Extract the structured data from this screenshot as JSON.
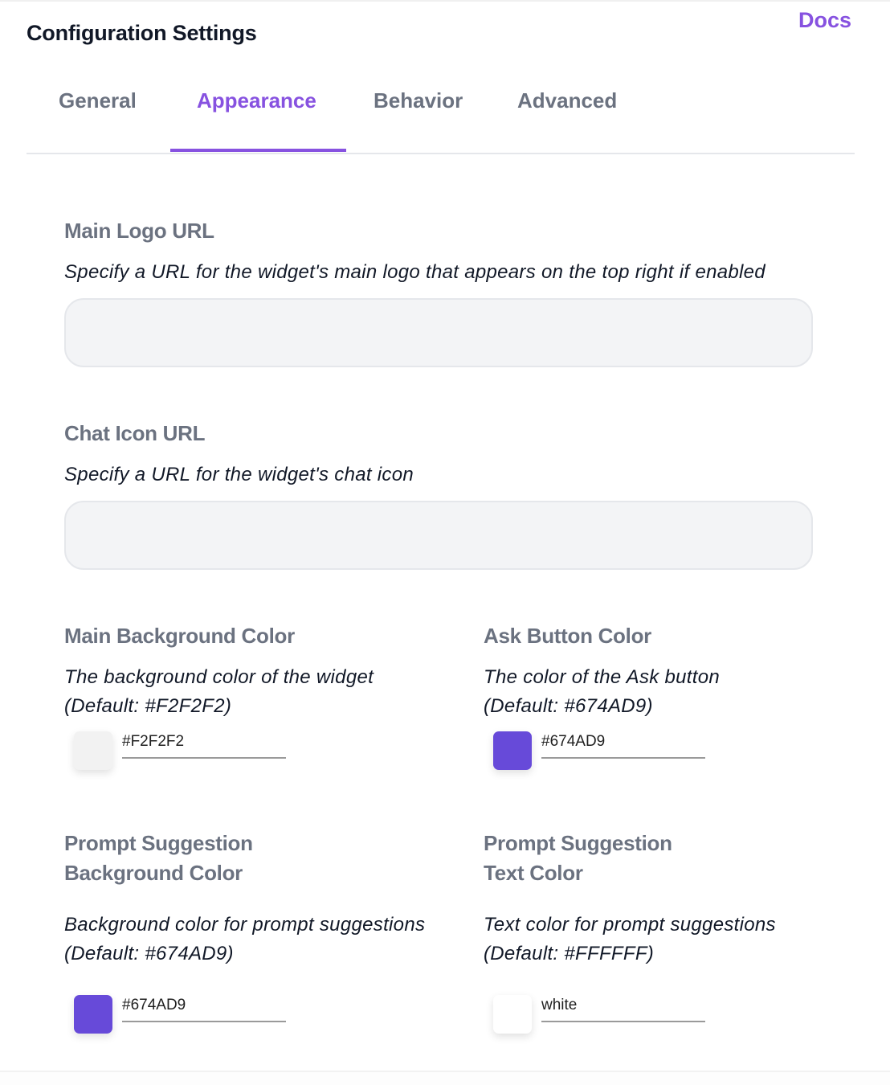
{
  "header": {
    "title": "Configuration Settings",
    "docs_link": "Docs"
  },
  "tabs": [
    {
      "label": "General",
      "active": false
    },
    {
      "label": "Appearance",
      "active": true
    },
    {
      "label": "Behavior",
      "active": false
    },
    {
      "label": "Advanced",
      "active": false
    }
  ],
  "fields": {
    "main_logo": {
      "label": "Main Logo URL",
      "description": "Specify a URL for the widget's main logo that appears on the top right if enabled",
      "value": ""
    },
    "chat_icon": {
      "label": "Chat Icon URL",
      "description": "Specify a URL for the widget's chat icon",
      "value": ""
    },
    "main_bg_color": {
      "label": "Main Background Color",
      "description_line1": "The background color of the widget",
      "description_line2": "(Default: #F2F2F2)",
      "value": "#F2F2F2",
      "swatch": "#F2F2F2"
    },
    "ask_button_color": {
      "label": "Ask Button Color",
      "description_line1": "The color of the Ask button",
      "description_line2": "(Default: #674AD9)",
      "value": "#674AD9",
      "swatch": "#674AD9"
    },
    "prompt_bg_color": {
      "label_line1": "Prompt Suggestion",
      "label_line2": "Background Color",
      "description_line1": "Background color for prompt suggestions",
      "description_line2": "(Default: #674AD9)",
      "value": "#674AD9",
      "swatch": "#674AD9"
    },
    "prompt_text_color": {
      "label_line1": "Prompt Suggestion",
      "label_line2": "Text Color",
      "description_line1": "Text color for prompt suggestions",
      "description_line2": "(Default: #FFFFFF)",
      "value": "white",
      "swatch": "#FFFFFF"
    }
  },
  "colors": {
    "accent": "#8752E0",
    "label_gray": "#6B7280"
  }
}
